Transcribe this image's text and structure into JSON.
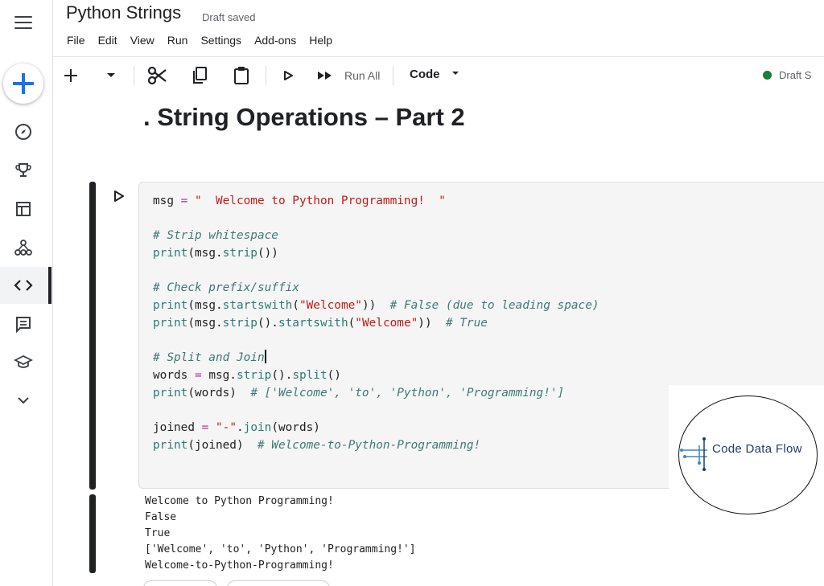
{
  "header": {
    "title": "Python Strings",
    "status_text": "Draft saved",
    "menu": [
      "File",
      "Edit",
      "View",
      "Run",
      "Settings",
      "Add-ons",
      "Help"
    ]
  },
  "toolbar": {
    "run_all_label": "Run All",
    "cell_type": "Code",
    "draft_status": "Draft S"
  },
  "sidebar": {
    "icons": [
      "menu-icon",
      "add-icon",
      "compass-icon",
      "trophy-icon",
      "table-icon",
      "models-icon",
      "code-icon",
      "comments-icon",
      "learn-icon",
      "chevron-down-icon"
    ],
    "active": "code-icon"
  },
  "notebook": {
    "heading": ". String Operations – Part 2",
    "code_lines": [
      {
        "t": "msg",
        "p": [
          [
            "",
            "msg "
          ],
          [
            "op",
            "="
          ],
          [
            "str",
            " \"  Welcome to Python Programming!  \""
          ]
        ]
      },
      {
        "t": "blank",
        "p": [
          [
            "",
            " "
          ]
        ]
      },
      {
        "t": "c1",
        "p": [
          [
            "cm",
            "# Strip whitespace"
          ]
        ]
      },
      {
        "t": "p1",
        "p": [
          [
            "kw",
            "print"
          ],
          [
            "",
            "(msg."
          ],
          [
            "kw",
            "strip"
          ],
          [
            "",
            "())"
          ]
        ]
      },
      {
        "t": "blank",
        "p": [
          [
            "",
            " "
          ]
        ]
      },
      {
        "t": "c2",
        "p": [
          [
            "cm",
            "# Check prefix/suffix"
          ]
        ]
      },
      {
        "t": "p2",
        "p": [
          [
            "kw",
            "print"
          ],
          [
            "",
            "(msg."
          ],
          [
            "kw",
            "startswith"
          ],
          [
            "",
            "("
          ],
          [
            "str",
            "\"Welcome\""
          ],
          [
            "",
            "))  "
          ],
          [
            "cm",
            "# False (due to leading space)"
          ]
        ]
      },
      {
        "t": "p3",
        "p": [
          [
            "kw",
            "print"
          ],
          [
            "",
            "(msg."
          ],
          [
            "kw",
            "strip"
          ],
          [
            "",
            "()."
          ],
          [
            "kw",
            "startswith"
          ],
          [
            "",
            "("
          ],
          [
            "str",
            "\"Welcome\""
          ],
          [
            "",
            "))  "
          ],
          [
            "cm",
            "# True"
          ]
        ]
      },
      {
        "t": "blank",
        "p": [
          [
            "",
            " "
          ]
        ]
      },
      {
        "t": "c3",
        "p": [
          [
            "cm",
            "# Split and Join"
          ]
        ]
      },
      {
        "t": "w",
        "p": [
          [
            "",
            "words "
          ],
          [
            "op",
            "="
          ],
          [
            "",
            " msg."
          ],
          [
            "kw",
            "strip"
          ],
          [
            "",
            "()."
          ],
          [
            "kw",
            "split"
          ],
          [
            "",
            "()"
          ]
        ]
      },
      {
        "t": "p4",
        "p": [
          [
            "kw",
            "print"
          ],
          [
            "",
            "(words)  "
          ],
          [
            "cm",
            "# ['Welcome', 'to', 'Python', 'Programming!']"
          ]
        ]
      },
      {
        "t": "blank",
        "p": [
          [
            "",
            " "
          ]
        ]
      },
      {
        "t": "j",
        "p": [
          [
            "",
            "joined "
          ],
          [
            "op",
            "="
          ],
          [
            "str",
            " \"-\""
          ],
          [
            "",
            "."
          ],
          [
            "kw",
            "join"
          ],
          [
            "",
            "(words)"
          ]
        ]
      },
      {
        "t": "p5",
        "p": [
          [
            "kw",
            "print"
          ],
          [
            "",
            "(joined)  "
          ],
          [
            "cm",
            "# Welcome-to-Python-Programming!"
          ]
        ]
      }
    ],
    "output_lines": [
      "Welcome to Python Programming!",
      "False",
      "True",
      "['Welcome', 'to', 'Python', 'Programming!']",
      "Welcome-to-Python-Programming!"
    ]
  },
  "watermark": {
    "brand": "Code Data Flow"
  },
  "colors": {
    "accent": "#1a73e8",
    "status_green": "#188038",
    "keyword": "#2b7a78",
    "string": "#c41a16",
    "operator": "#a626a4"
  }
}
